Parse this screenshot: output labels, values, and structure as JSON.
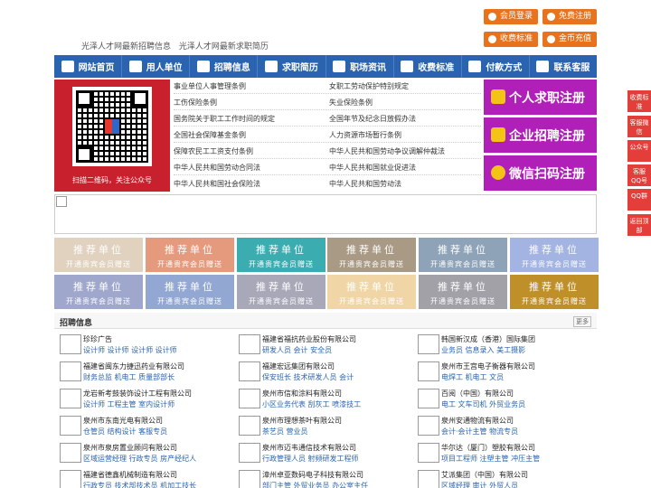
{
  "header": {
    "links": [
      "光泽人才网最新招聘信息",
      "光泽人才网最新求职简历"
    ],
    "buttons": {
      "member_login": "会员登录",
      "free_register": "免费注册",
      "fee_standard": "收费标准",
      "coin_recharge": "金币充值"
    }
  },
  "nav": [
    "网站首页",
    "用人单位",
    "招聘信息",
    "求职简历",
    "职场资讯",
    "收费标准",
    "付款方式",
    "联系客服"
  ],
  "qr": {
    "caption": "扫描二维码，关注公众号"
  },
  "laws": [
    "事业单位人事管理条例",
    "女职工劳动保护特别规定",
    "工伤保险条例",
    "失业保险条例",
    "国务院关于职工工作时间的规定",
    "全国年节及纪念日放假办法",
    "全国社会保障基金条例",
    "人力资源市场暂行条例",
    "保障农民工工资支付条例",
    "中华人民共和国劳动争议调解仲裁法",
    "中华人民共和国劳动合同法",
    "中华人民共和国就业促进法",
    "中华人民共和国社会保险法",
    "中华人民共和国劳动法"
  ],
  "register": [
    "个人求职注册",
    "企业招聘注册",
    "微信扫码注册"
  ],
  "side": [
    "收费标准",
    "客服微信",
    "公众号",
    "客服QQ号",
    "QQ群",
    "返回顶部"
  ],
  "recommend": {
    "title": "推荐单位",
    "subtitle": "开通贵宾会员赠送",
    "colors": [
      "#e0d2be",
      "#e59a7e",
      "#3bacb0",
      "#a89a84",
      "#8fa3b8",
      "#a3b3e2",
      "#9fa7cc",
      "#92a7d2",
      "#a8a8b8",
      "#f0d6a6",
      "#a3a1a8",
      "#bf8f2a"
    ]
  },
  "jobs": {
    "title": "招聘信息",
    "more": "更多",
    "items": [
      {
        "company": "珍珍广告",
        "positions": "设计师 设计师 设计师 设计师"
      },
      {
        "company": "福建省福抗药业股份有限公司",
        "positions": "研发人员 会计 安全员"
      },
      {
        "company": "韩国新汉成（香港）国际集团",
        "positions": "业务员 信息录入 美工摄影"
      },
      {
        "company": "福建省闽东力捷迅药业有限公司",
        "positions": "财务总监 机电工 质量部部长"
      },
      {
        "company": "福建宏远集团有限公司",
        "positions": "保安班长 技术研发人员 会计"
      },
      {
        "company": "泉州市王宫电子衡器有限公司",
        "positions": "电焊工 机电工 文员"
      },
      {
        "company": "龙岩新考鼓装饰设计工程有限公司",
        "positions": "设计师 工程主管 室内设计师"
      },
      {
        "company": "泉州市信和涂料有限公司",
        "positions": "小区业务代表 刮灰工 喷漆技工"
      },
      {
        "company": "百阅（中国）有限公司",
        "positions": "电工 文车司机 外贸业务员"
      },
      {
        "company": "泉州市东南光电有限公司",
        "positions": "仓管员 结构设计 客服专员"
      },
      {
        "company": "泉州市理想茶叶有限公司",
        "positions": "茶艺员 营业员"
      },
      {
        "company": "泉州安通物流有限公司",
        "positions": "会计·会计主管 物流专员"
      },
      {
        "company": "泉州市泉房置业顾问有限公司",
        "positions": "区域运营经理 行政专员 房产经纪人"
      },
      {
        "company": "泉州市迈韦通信技术有限公司",
        "positions": "行政管理人员 射频研发工程师"
      },
      {
        "company": "华尔达（厦门）塑胶有限公司",
        "positions": "项目工程师 注塑主管 冲压主管"
      },
      {
        "company": "福建省德鑫机械制造有限公司",
        "positions": "行政专员 技术部技术员 机加工技长"
      },
      {
        "company": "漳州卓亚数码电子科技有限公司",
        "positions": "部门主管 外贸业务员 办公室主任"
      },
      {
        "company": "艾派集团（中国）有限公司",
        "positions": "区域经理 审计 外贸人员"
      }
    ]
  }
}
